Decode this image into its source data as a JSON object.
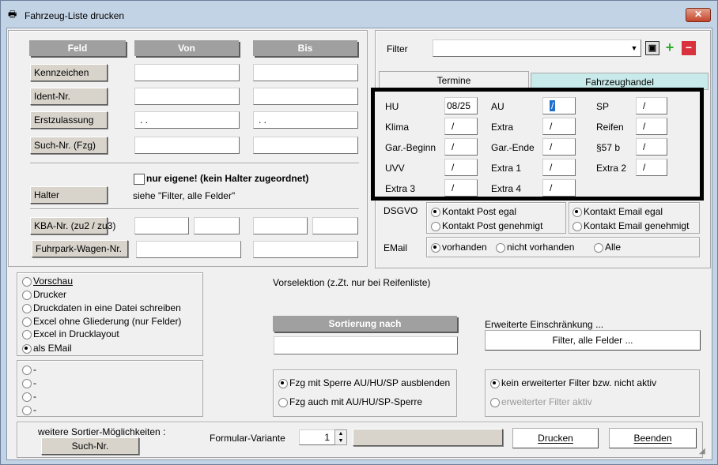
{
  "window": {
    "title": "Fahrzeug-Liste drucken",
    "icon": "printer-icon",
    "close_glyph": "✕"
  },
  "left_panel": {
    "headers": {
      "feld": "Feld",
      "von": "Von",
      "bis": "Bis"
    },
    "rows": [
      {
        "label": "Kennzeichen",
        "von": "",
        "bis": ""
      },
      {
        "label": "Ident-Nr.",
        "von": "",
        "bis": ""
      },
      {
        "label": "Erstzulassung",
        "von": ". .",
        "bis": ". ."
      },
      {
        "label": "Such-Nr. (Fzg)",
        "von": "",
        "bis": ""
      }
    ],
    "nur_eigene": "nur eigene! (kein Halter zugeordnet)",
    "halter_label": "Halter",
    "halter_hint": "siehe \"Filter, alle Felder\"",
    "kba_label": "KBA-Nr. (zu2 / zu3)",
    "fuhrpark_label": "Fuhrpark-Wagen-Nr."
  },
  "filter": {
    "label": "Filter",
    "value": "",
    "save_icon": "save-icon",
    "add_icon": "plus-icon",
    "remove_icon": "minus-icon"
  },
  "tabs": [
    {
      "label": "Termine",
      "active": true
    },
    {
      "label": "Fahrzeughandel",
      "active": false
    }
  ],
  "termine": [
    {
      "label": "HU",
      "value": "08/25"
    },
    {
      "label": "AU",
      "value": "/"
    },
    {
      "label": "SP",
      "value": "/"
    },
    {
      "label": "Klima",
      "value": "/"
    },
    {
      "label": "Extra",
      "value": "/"
    },
    {
      "label": "Reifen",
      "value": "/"
    },
    {
      "label": "Gar.-Beginn",
      "value": "/"
    },
    {
      "label": "Gar.-Ende",
      "value": "/"
    },
    {
      "label": "§57 b",
      "value": "/"
    },
    {
      "label": "UVV",
      "value": "/"
    },
    {
      "label": "Extra 1",
      "value": "/"
    },
    {
      "label": "Extra 2",
      "value": "/"
    },
    {
      "label": "Extra 3",
      "value": "/"
    },
    {
      "label": "Extra 4",
      "value": "/"
    }
  ],
  "dsgvo": {
    "label": "DSGVO",
    "post_egal": "Kontakt Post egal",
    "post_gen": "Kontakt Post genehmigt",
    "email_egal": "Kontakt Email egal",
    "email_gen": "Kontakt Email genehmigt"
  },
  "email": {
    "label": "EMail",
    "vorhanden": "vorhanden",
    "nicht": "nicht vorhanden",
    "alle": "Alle"
  },
  "output": {
    "options": [
      "Vorschau",
      "Drucker",
      "Druckdaten in eine Datei schreiben",
      "Excel ohne Gliederung (nur Felder)",
      "Excel in Drucklayout",
      "als EMail"
    ],
    "selected": 5
  },
  "dash_options": [
    "-",
    "-",
    "-",
    "-"
  ],
  "vorselektion": "Vorselektion (z.Zt. nur bei Reifenliste)",
  "sortierung": {
    "header": "Sortierung nach",
    "value": ""
  },
  "erweitert": {
    "label": "Erweiterte Einschränkung ...",
    "button": "Filter, alle Felder ..."
  },
  "sperre": {
    "opt1": "Fzg mit Sperre AU/HU/SP ausblenden",
    "opt2": "Fzg auch mit AU/HU/SP-Sperre"
  },
  "filter_status": {
    "opt1": "kein erweiterter Filter bzw. nicht aktiv",
    "opt2": "erweiterter Filter aktiv"
  },
  "bottom": {
    "weitere_label": "weitere Sortier-Möglichkeiten :",
    "such_nr": "Such-Nr.",
    "formular_label": "Formular-Variante",
    "formular_value": "1",
    "drucken": "Drucken",
    "beenden": "Beenden"
  }
}
